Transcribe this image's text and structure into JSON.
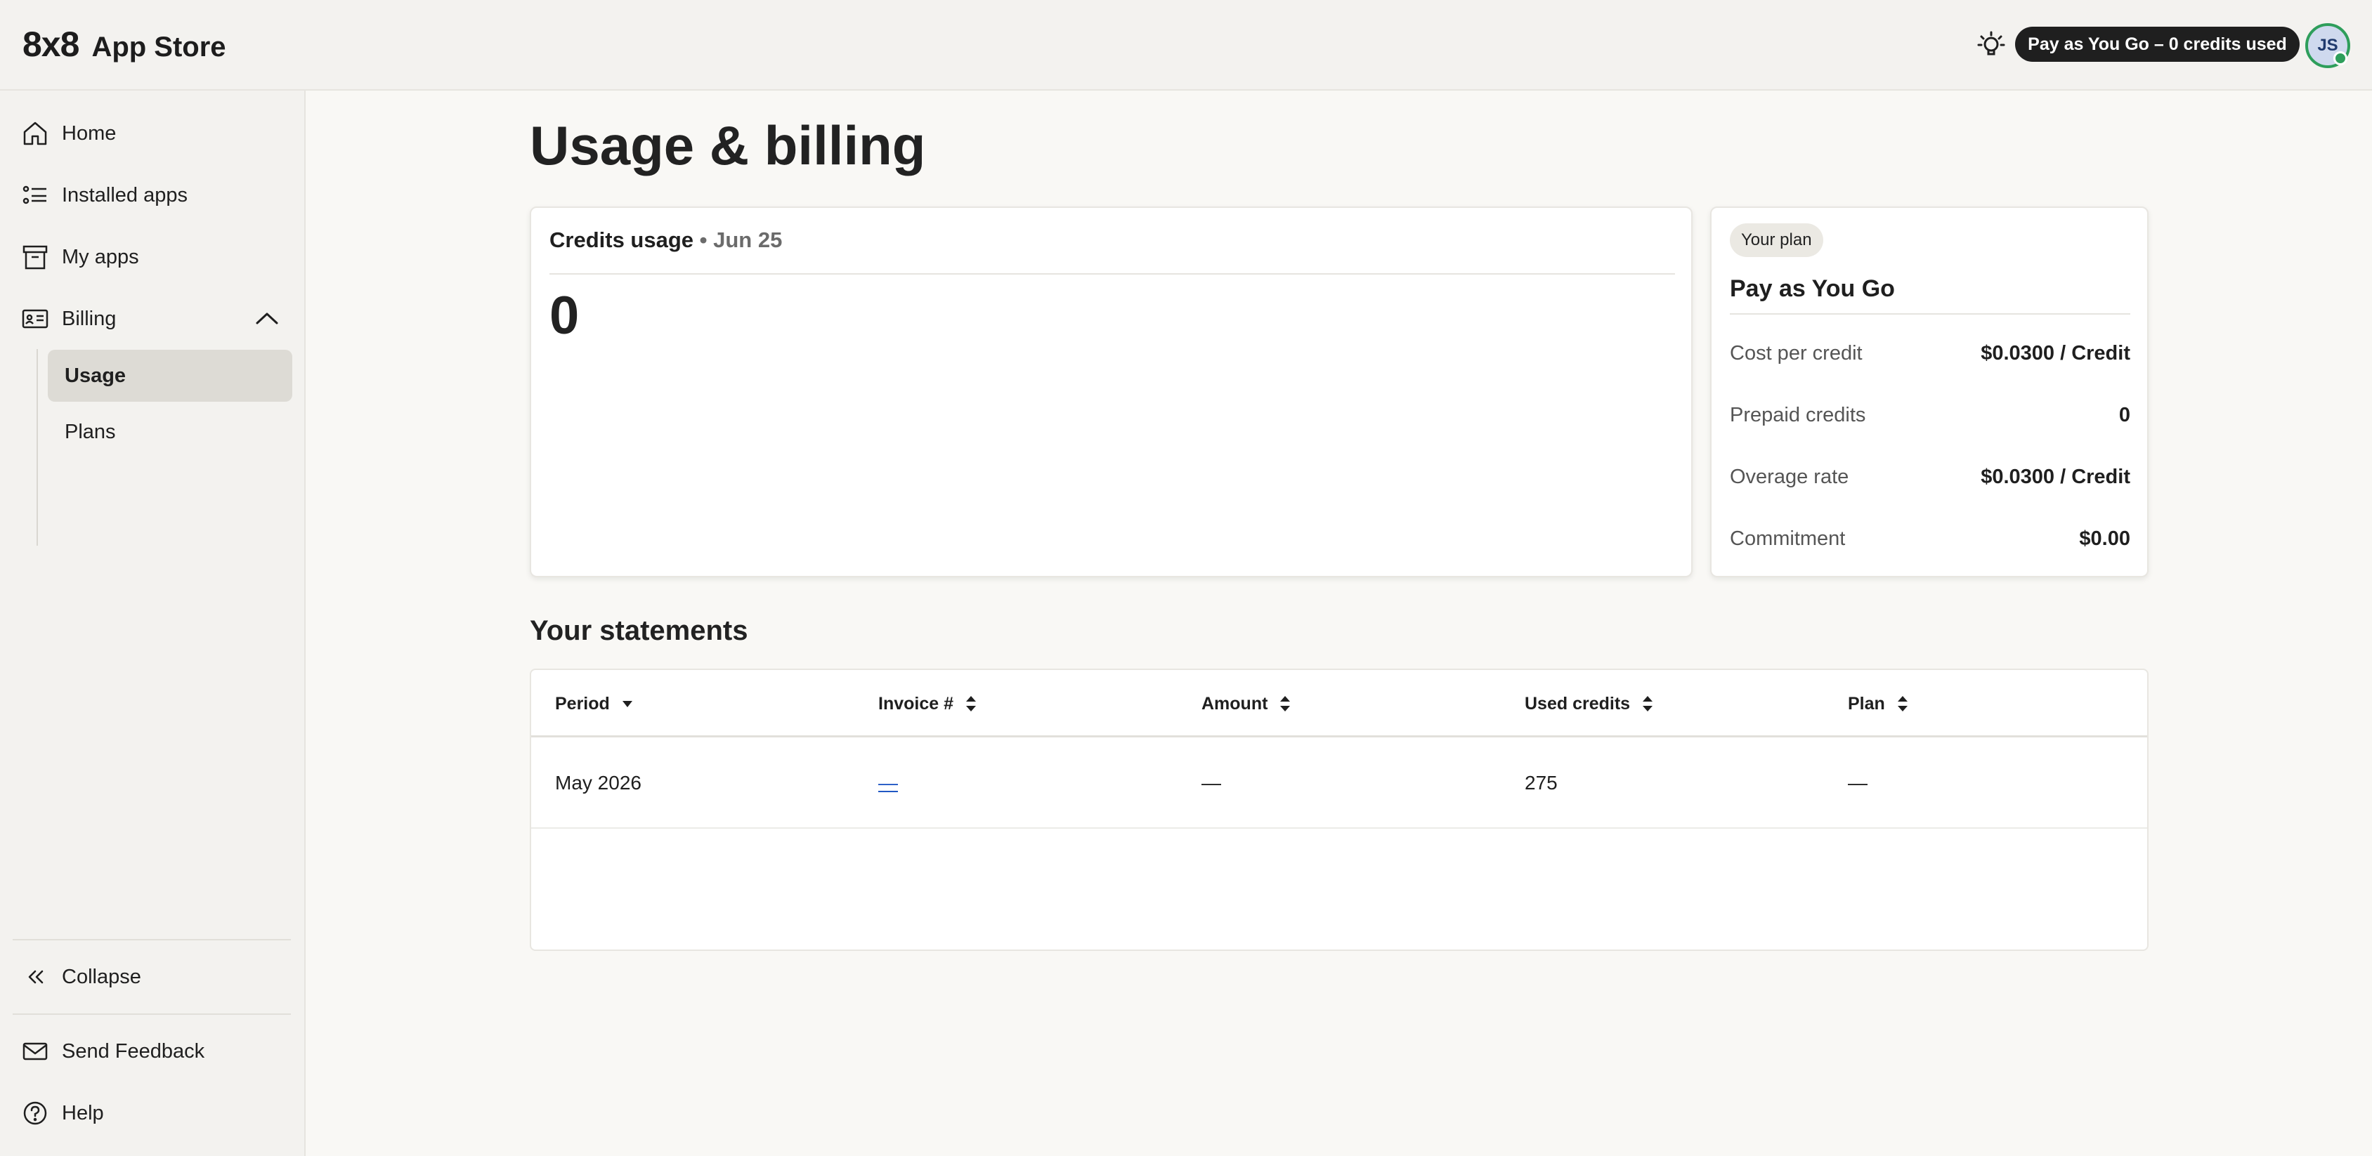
{
  "header": {
    "logo_mark": "8x8",
    "app_name": "App Store",
    "plan_status": "Pay as You Go – 0 credits used",
    "avatar_initials": "JS"
  },
  "sidebar": {
    "items": [
      {
        "label": "Home",
        "icon": "home-icon"
      },
      {
        "label": "Installed apps",
        "icon": "list-icon"
      },
      {
        "label": "My apps",
        "icon": "archive-icon"
      },
      {
        "label": "Billing",
        "icon": "id-card-icon"
      }
    ],
    "billing_subitems": [
      {
        "label": "Usage",
        "active": true
      },
      {
        "label": "Plans",
        "active": false
      }
    ],
    "collapse_label": "Collapse",
    "feedback_label": "Send Feedback",
    "help_label": "Help"
  },
  "main": {
    "title": "Usage & billing",
    "credits_card": {
      "title": "Credits usage",
      "date": "• Jun 25",
      "value": "0"
    },
    "plan_card": {
      "badge": "Your plan",
      "name": "Pay as You Go",
      "rows": [
        {
          "key": "Cost per credit",
          "value": "$0.0300 / Credit"
        },
        {
          "key": "Prepaid credits",
          "value": "0"
        },
        {
          "key": "Overage rate",
          "value": "$0.0300 / Credit"
        },
        {
          "key": "Commitment",
          "value": "$0.00"
        }
      ]
    },
    "statements": {
      "title": "Your statements",
      "columns": [
        "Period",
        "Invoice #",
        "Amount",
        "Used credits",
        "Plan"
      ],
      "rows": [
        {
          "period": "May 2026",
          "invoice": "—",
          "amount": "—",
          "used_credits": "275",
          "plan": "—"
        }
      ]
    }
  },
  "colors": {
    "header_bg": "#f3f2ef",
    "pill_bg": "#1f1f1f",
    "avatar_ring": "#2e9e5b",
    "link": "#2158c4"
  }
}
